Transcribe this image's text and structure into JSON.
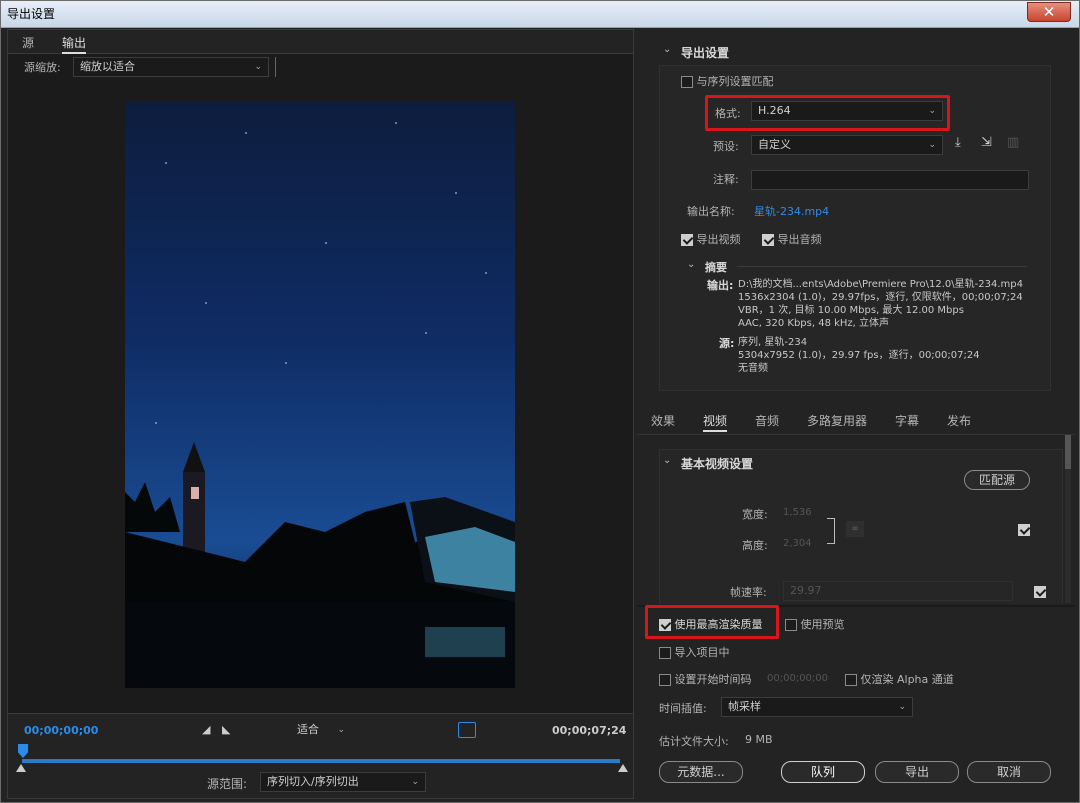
{
  "window": {
    "title": "导出设置",
    "close_glyph": "✕"
  },
  "left": {
    "tabs": [
      "源",
      "输出"
    ],
    "source_zoom_label": "源缩放:",
    "source_zoom_value": "缩放以适合",
    "timecode_start": "00;00;00;00",
    "timecode_end": "00;00;07;24",
    "fit_value": "适合",
    "range_label": "源范围:",
    "range_value": "序列切入/序列切出"
  },
  "export_settings": {
    "header": "导出设置",
    "match_sequence": "与序列设置匹配",
    "format_label": "格式:",
    "format_value": "H.264",
    "preset_label": "预设:",
    "preset_value": "自定义",
    "comment_label": "注释:",
    "output_name_label": "输出名称:",
    "output_name_value": "星轨-234.mp4",
    "export_video": "导出视频",
    "export_audio": "导出音频",
    "summary_header": "摘要",
    "output_label": "输出:",
    "output_lines": [
      "D:\\我的文档...ents\\Adobe\\Premiere Pro\\12.0\\星轨-234.mp4",
      "1536x2304 (1.0)，29.97fps，逐行, 仅限软件，00;00;07;24",
      "VBR，1 次, 目标 10.00 Mbps, 最大 12.00 Mbps",
      "AAC, 320 Kbps, 48 kHz, 立体声"
    ],
    "source_label": "源:",
    "source_lines": [
      "序列, 星轨-234",
      "5304x7952 (1.0)，29.97 fps，逐行，00;00;07;24",
      "无音频"
    ]
  },
  "panel_tabs": [
    "效果",
    "视频",
    "音频",
    "多路复用器",
    "字幕",
    "发布"
  ],
  "video": {
    "header": "基本视频设置",
    "match_source": "匹配源",
    "width_label": "宽度:",
    "width_value": "1,536",
    "height_label": "高度:",
    "height_value": "2,304",
    "framerate_label": "帧速率:",
    "framerate_value": "29.97"
  },
  "bottom": {
    "max_render_quality": "使用最高渲染质量",
    "use_previews": "使用预览",
    "import_into_project": "导入项目中",
    "set_start_timecode": "设置开始时间码",
    "start_timecode_value": "00;00;00;00",
    "render_alpha_only": "仅渲染 Alpha 通道",
    "time_interp_label": "时间插值:",
    "time_interp_value": "帧采样",
    "file_size_label": "估计文件大小:",
    "file_size_value": "9 MB",
    "metadata_button": "元数据...",
    "queue_button": "队列",
    "export_button": "导出",
    "cancel_button": "取消"
  },
  "colors": {
    "accent": "#2d8ceb",
    "highlight": "#d6161b",
    "panel": "#232323"
  }
}
